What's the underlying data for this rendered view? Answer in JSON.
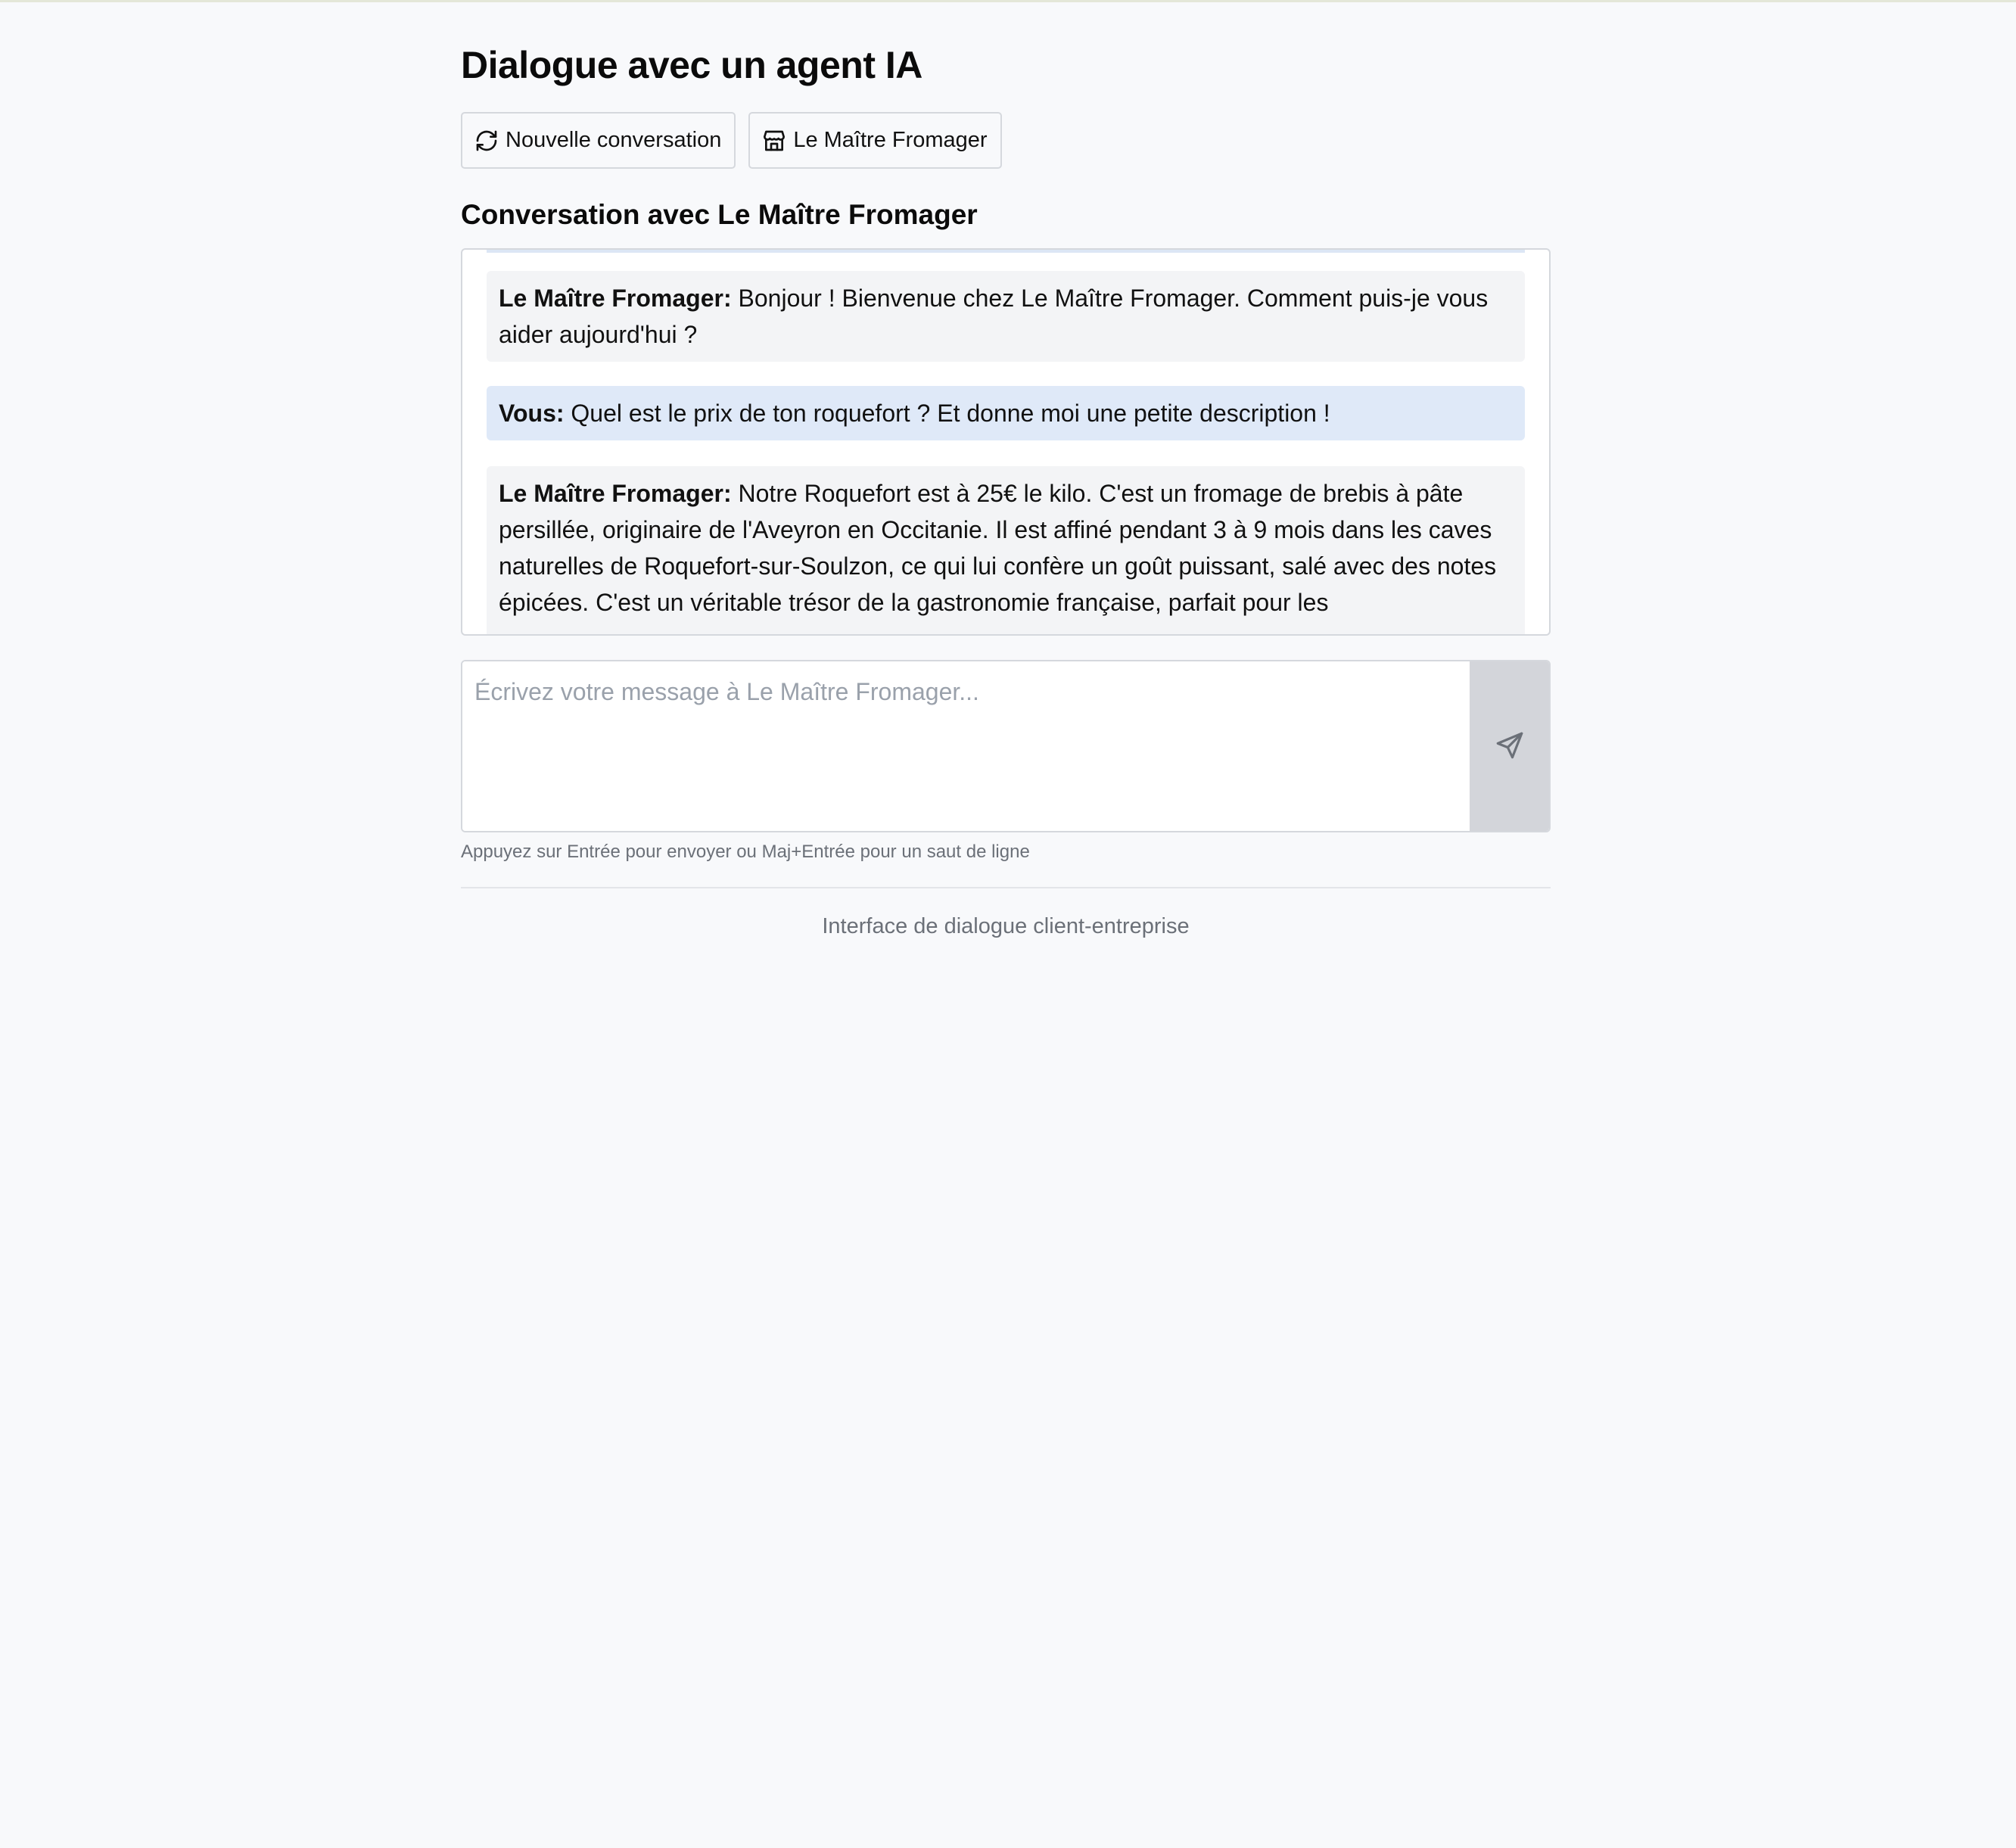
{
  "page": {
    "title": "Dialogue avec un agent IA"
  },
  "toolbar": {
    "new_conversation_label": "Nouvelle conversation",
    "company_label": "Le Maître Fromager"
  },
  "conversation": {
    "heading": "Conversation avec Le Maître Fromager",
    "messages": [
      {
        "role": "agent",
        "sender": "Le Maître Fromager:",
        "text": "Bonjour ! Bienvenue chez Le Maître Fromager. Comment puis-je vous aider aujourd'hui ?"
      },
      {
        "role": "user",
        "sender": "Vous:",
        "text": "Quel est le prix de ton roquefort ? Et donne moi une petite description !"
      },
      {
        "role": "agent",
        "sender": "Le Maître Fromager:",
        "text": "Notre Roquefort est à 25€ le kilo. C'est un fromage de brebis à pâte persillée, originaire de l'Aveyron en Occitanie. Il est affiné pendant 3 à 9 mois dans les caves naturelles de Roquefort-sur-Soulzon, ce qui lui confère un goût puissant, salé avec des notes épicées. C'est un véritable trésor de la gastronomie française, parfait pour les"
      }
    ]
  },
  "composer": {
    "placeholder": "Écrivez votre message à Le Maître Fromager...",
    "value": "",
    "hint": "Appuyez sur Entrée pour envoyer ou Maj+Entrée pour un saut de ligne"
  },
  "footer": {
    "text": "Interface de dialogue client-entreprise"
  },
  "icons": {
    "refresh": "refresh-icon",
    "store": "store-icon",
    "send": "send-icon"
  },
  "colors": {
    "background": "#f8f9fb",
    "agent_bubble": "#f3f4f6",
    "user_bubble": "#dfe9f8",
    "send_button": "#d3d5da",
    "muted_text": "#6b7078"
  }
}
